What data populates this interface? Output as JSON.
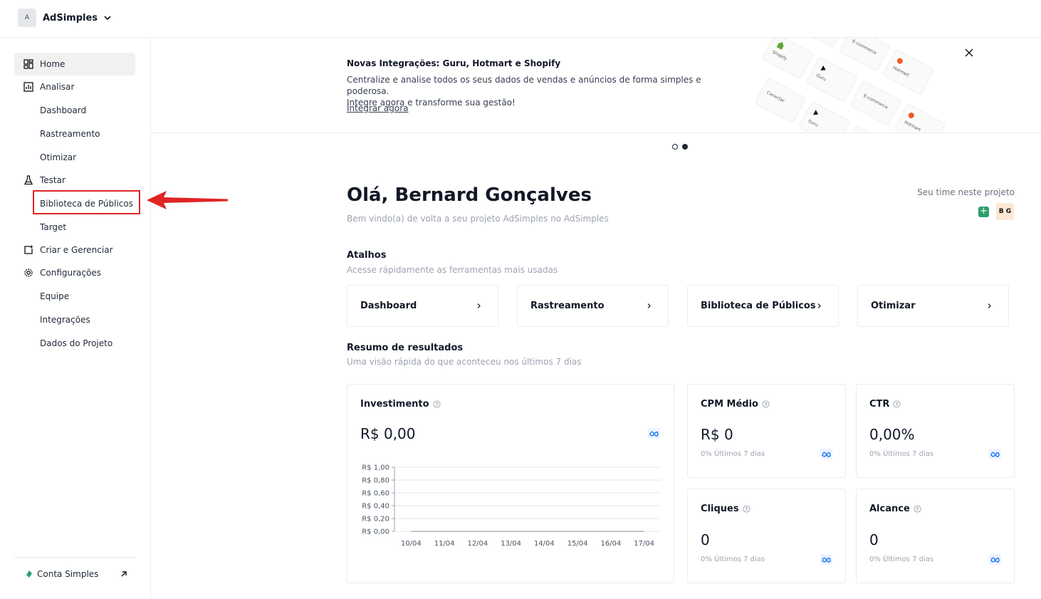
{
  "workspace": {
    "initial": "A",
    "name": "AdSimples"
  },
  "sidebar": {
    "items": [
      {
        "label": "Home"
      },
      {
        "label": "Analisar"
      },
      {
        "label": "Dashboard"
      },
      {
        "label": "Rastreamento"
      },
      {
        "label": "Otimizar"
      },
      {
        "label": "Testar"
      },
      {
        "label": "Biblioteca de Públicos"
      },
      {
        "label": "Target"
      },
      {
        "label": "Criar e Gerenciar"
      },
      {
        "label": "Configurações"
      },
      {
        "label": "Equipe"
      },
      {
        "label": "Integrações"
      },
      {
        "label": "Dados do Projeto"
      }
    ],
    "footer_label": "Conta Simples",
    "highlight_color": "#e02424"
  },
  "banner": {
    "title": "Novas Integrações: Guru, Hotmart e Shopify",
    "line1": "Centralize e analise todos os seus dados de vendas e anúncios de forma simples e poderosa.",
    "line2": "Integre agora e transforme sua gestão!",
    "link": "Integrar agora",
    "art_labels": [
      "Shopify",
      "E-commerce",
      "Hotmart",
      "Guru",
      "Conectar"
    ]
  },
  "greeting": {
    "title": "Olá, Bernard Gonçalves",
    "subtitle": "Bem vindo(a) de volta a seu projeto AdSimples no AdSimples",
    "team_label": "Seu time neste projeto",
    "team_add": "+",
    "team_member": "B G"
  },
  "shortcuts": {
    "title": "Atalhos",
    "subtitle": "Acesse rápidamente as ferramentas mais usadas",
    "items": [
      "Dashboard",
      "Rastreamento",
      "Biblioteca de Públicos",
      "Otimizar"
    ]
  },
  "results": {
    "title": "Resumo de resultados",
    "subtitle": "Uma visão rápida do que aconteceu nos últimos 7 dias",
    "investimento": {
      "label": "Investimento",
      "value": "R$ 0,00"
    },
    "cpm": {
      "label": "CPM Médio",
      "value": "R$ 0",
      "foot": "0% Últimos 7 dias"
    },
    "ctr": {
      "label": "CTR",
      "value": "0,00%",
      "foot": "0% Últimos 7 dias"
    },
    "cliques": {
      "label": "Cliques",
      "value": "0",
      "foot": "0% Últimos 7 dias"
    },
    "alcance": {
      "label": "Alcance",
      "value": "0",
      "foot": "0% Últimos 7 dias"
    }
  },
  "chart_data": {
    "type": "line",
    "categories": [
      "10/04",
      "11/04",
      "12/04",
      "13/04",
      "14/04",
      "15/04",
      "16/04",
      "17/04"
    ],
    "series": [
      {
        "values": [
          0,
          0,
          0,
          0,
          0,
          0,
          0,
          0
        ]
      }
    ],
    "y_ticks": [
      "R$ 0,00",
      "R$ 0,20",
      "R$ 0,40",
      "R$ 0,60",
      "R$ 0,80",
      "R$ 1,00"
    ],
    "ylim": [
      0,
      1
    ],
    "grid": true
  },
  "colors": {
    "accent_green": "#2f9e6e",
    "meta_blue": "#1877f2",
    "arrow_red": "#e02424"
  }
}
